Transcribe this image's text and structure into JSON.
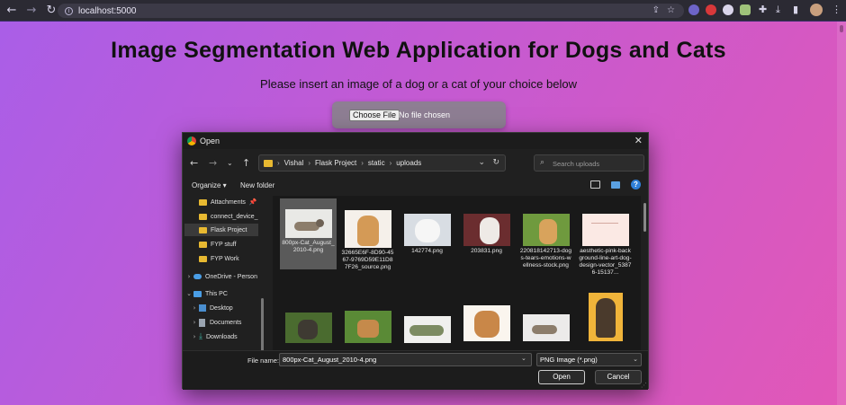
{
  "browser": {
    "url": "localhost:5000"
  },
  "page": {
    "title": "Image Segmentation Web Application for Dogs and Cats",
    "subtitle": "Please insert an image of a dog or a cat of your choice below",
    "choose_file_label": "Choose File",
    "no_file_text": "No file chosen"
  },
  "dialog": {
    "title": "Open",
    "breadcrumb": [
      "Vishal",
      "Flask Project",
      "static",
      "uploads"
    ],
    "search_placeholder": "Search uploads",
    "organize_label": "Organize ▾",
    "new_folder_label": "New folder",
    "nav_items": [
      {
        "label": "Attachments",
        "icon": "folder-icon"
      },
      {
        "label": "connect_device_",
        "icon": "folder-icon"
      },
      {
        "label": "Flask Project",
        "icon": "folder-icon"
      },
      {
        "label": "FYP stuff",
        "icon": "folder-icon"
      },
      {
        "label": "FYP Work",
        "icon": "folder-icon"
      },
      {
        "label": "OneDrive - Person",
        "icon": "cloud-icon"
      },
      {
        "label": "This PC",
        "icon": "computer-icon"
      },
      {
        "label": "Desktop",
        "icon": "desktop-icon"
      },
      {
        "label": "Documents",
        "icon": "documents-icon"
      },
      {
        "label": "Downloads",
        "icon": "download-icon"
      }
    ],
    "files": [
      {
        "name": "800px-Cat_August_2010-4.png"
      },
      {
        "name": "32665E6F-8D90-4567-9769D59E11D87F26_source.png"
      },
      {
        "name": "142774.png"
      },
      {
        "name": "203831.png"
      },
      {
        "name": "220818142713-dogs-tears-emotions-wellness-stock.png"
      },
      {
        "name": "aesthetic-pink-background-line-art-dog-design-vector_53876-15137..."
      },
      {
        "name": ""
      },
      {
        "name": ""
      },
      {
        "name": ""
      },
      {
        "name": ""
      },
      {
        "name": ""
      },
      {
        "name": ""
      }
    ],
    "file_name_label": "File name:",
    "file_name_value": "800px-Cat_August_2010-4.png",
    "file_type": "PNG Image (*.png)",
    "open_label": "Open",
    "cancel_label": "Cancel"
  }
}
